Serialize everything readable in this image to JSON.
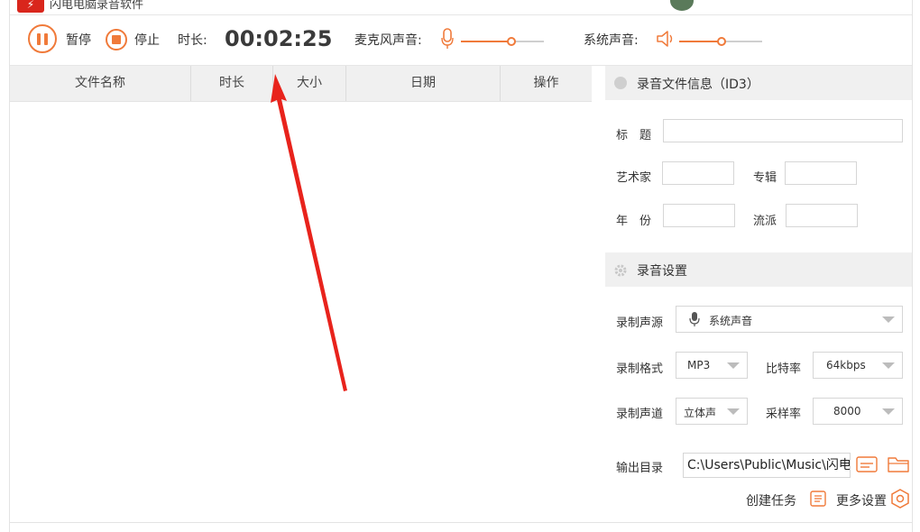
{
  "window": {
    "title": "闪电电脑录音软件"
  },
  "toolbar": {
    "pause_label": "暂停",
    "stop_label": "停止",
    "duration_label": "时长:",
    "duration_value": "00:02:25",
    "mic_label": "麦克风声音:",
    "mic_level": 0.6,
    "system_label": "系统声音:",
    "system_level": 0.5
  },
  "table": {
    "columns": [
      "文件名称",
      "时长",
      "大小",
      "日期",
      "操作"
    ],
    "rows": []
  },
  "id3": {
    "section_title": "录音文件信息（ID3）",
    "title_label": "标　题",
    "title_value": "",
    "artist_label": "艺术家",
    "artist_value": "",
    "album_label": "专辑",
    "album_value": "",
    "year_label": "年　份",
    "year_value": "",
    "genre_label": "流派",
    "genre_value": ""
  },
  "settings": {
    "section_title": "录音设置",
    "source_label": "录制声源",
    "source_value": "系统声音",
    "format_label": "录制格式",
    "format_value": "MP3",
    "bitrate_label": "比特率",
    "bitrate_value": "64kbps",
    "channel_label": "录制声道",
    "channel_value": "立体声",
    "samplerate_label": "采样率",
    "samplerate_value": "8000",
    "output_label": "输出目录",
    "output_value": "C:\\Users\\Public\\Music\\闪电",
    "create_task_label": "创建任务",
    "more_settings_label": "更多设置"
  },
  "colors": {
    "accent": "#f07a3a",
    "annotation": "#e8231c"
  }
}
